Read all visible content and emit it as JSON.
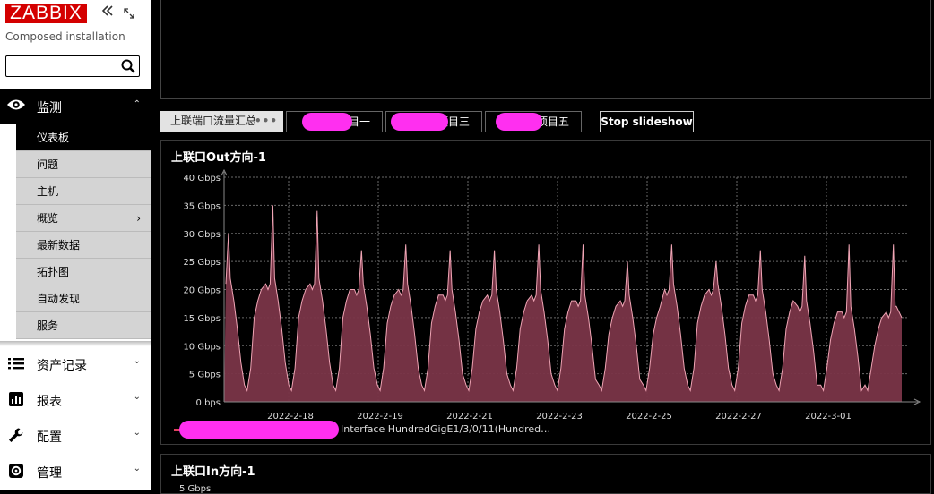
{
  "app": {
    "logo_text": "ZABBIX",
    "server_name": "Composed installation",
    "brand_color": "#d40000"
  },
  "sidebar": {
    "search": {
      "value": "",
      "placeholder": ""
    },
    "monitoring": {
      "label": "监测",
      "items": [
        {
          "label": "仪表板",
          "active": true
        },
        {
          "label": "问题"
        },
        {
          "label": "主机"
        },
        {
          "label": "概览",
          "has_submenu": true
        },
        {
          "label": "最新数据"
        },
        {
          "label": "拓扑图"
        },
        {
          "label": "自动发现"
        },
        {
          "label": "服务"
        }
      ]
    },
    "menu": [
      {
        "label": "资产记录",
        "icon": "list-icon"
      },
      {
        "label": "报表",
        "icon": "bar-chart-icon"
      },
      {
        "label": "配置",
        "icon": "wrench-icon"
      },
      {
        "label": "管理",
        "icon": "gear-icon"
      }
    ]
  },
  "tabs": [
    {
      "label": "上联端口流量汇总",
      "active": true
    },
    {
      "label": "项目一"
    },
    {
      "label": "项目三"
    },
    {
      "label": "项目五"
    }
  ],
  "toolbar": {
    "stop_slideshow": "Stop slideshow"
  },
  "widgets": [
    {
      "title": "上联口Out方向-1",
      "legend": "Interface HundredGigE1/3/0/11(Hundred…"
    },
    {
      "title": "上联口In方向-1",
      "first_tick": "5 Gbps"
    }
  ],
  "chart_data": {
    "type": "area",
    "unit": "Gbps",
    "ylim": [
      0,
      40
    ],
    "y_ticks": [
      "0 bps",
      "5 Gbps",
      "10 Gbps",
      "15 Gbps",
      "20 Gbps",
      "25 Gbps",
      "30 Gbps",
      "35 Gbps",
      "40 Gbps"
    ],
    "x_ticks": [
      "2022-2-18",
      "2022-2-19",
      "2022-2-21",
      "2022-2-23",
      "2022-2-25",
      "2022-2-27",
      "2022-3-01"
    ],
    "grid": true,
    "series": [
      {
        "name": "",
        "color": "#e0445e",
        "fill": "#7a3548",
        "daily_peaks": [
          30,
          35,
          34,
          27,
          28,
          27,
          27,
          28,
          28,
          25,
          28,
          25,
          27,
          26,
          28,
          28
        ],
        "daily_shoulders": [
          21,
          21,
          21,
          20,
          20,
          19,
          19,
          19,
          18,
          18,
          20,
          20,
          19,
          17,
          16,
          16
        ],
        "daily_min": [
          2,
          2,
          2,
          2,
          2,
          2,
          2,
          2,
          2,
          2,
          2,
          2,
          2,
          2,
          2,
          2
        ],
        "last_value": 15
      }
    ]
  }
}
